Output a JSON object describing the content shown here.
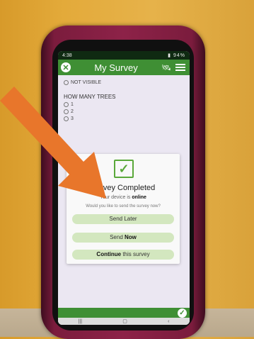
{
  "status_bar": {
    "time": "4:38",
    "battery": "94%"
  },
  "app_bar": {
    "title": "My Survey"
  },
  "survey": {
    "prev_option": "NOT VISIBLE",
    "question": "HOW MANY TREES",
    "options": [
      "1",
      "2",
      "3"
    ]
  },
  "dialog": {
    "title": "Survey Completed",
    "device_prefix": "Your device is",
    "device_status": "online",
    "prompt": "Would you like to send the survey now?",
    "send_later": "Send Later",
    "send_now_a": "Send",
    "send_now_b": "Now",
    "continue_a": "Continue",
    "continue_b": "this survey"
  },
  "nav": {
    "recent": "|||",
    "home": "▢",
    "back": "‹"
  },
  "colors": {
    "app_green": "#3f8f34",
    "button_green": "#d3e7bf",
    "arrow_orange": "#e8762b"
  }
}
